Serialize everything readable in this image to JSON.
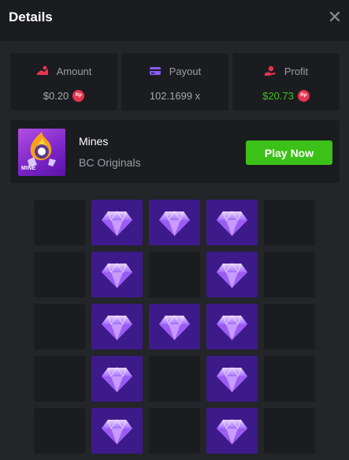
{
  "modal": {
    "title": "Details",
    "close_label": "✕"
  },
  "stats": [
    {
      "icon": "amount-icon",
      "label": "Amount",
      "value": "$0.20",
      "currency_badge": "Rp",
      "value_color": "#a5a8ae"
    },
    {
      "icon": "payout-icon",
      "label": "Payout",
      "value": "102.1699 x",
      "currency_badge": "",
      "value_color": "#a5a8ae"
    },
    {
      "icon": "profit-icon",
      "label": "Profit",
      "value": "$20.73",
      "currency_badge": "Rp",
      "value_color": "#3bc117"
    }
  ],
  "game": {
    "thumbnail_label": "MINE",
    "name": "Mines",
    "provider": "BC Originals",
    "play_label": "Play Now"
  },
  "board": {
    "columns": 5,
    "rows": 5,
    "cells": [
      [
        false,
        true,
        true,
        true,
        false
      ],
      [
        false,
        true,
        false,
        true,
        false
      ],
      [
        false,
        true,
        true,
        true,
        false
      ],
      [
        false,
        true,
        false,
        true,
        false
      ],
      [
        false,
        true,
        false,
        true,
        false
      ]
    ]
  },
  "colors": {
    "accent_green": "#3bc117",
    "currency_red": "#e8334f",
    "gem_tile": "#3d1a8a",
    "empty_tile": "#1b1c1f"
  }
}
